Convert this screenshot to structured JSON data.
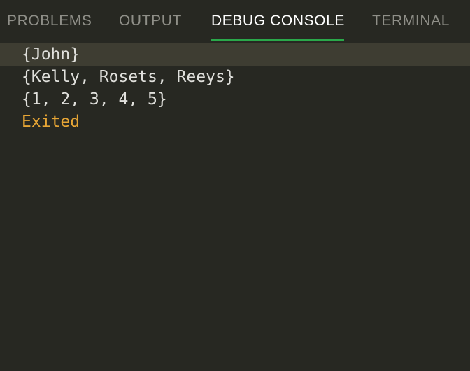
{
  "tabs": [
    {
      "label": "PROBLEMS",
      "active": false
    },
    {
      "label": "OUTPUT",
      "active": false
    },
    {
      "label": "DEBUG CONSOLE",
      "active": true
    },
    {
      "label": "TERMINAL",
      "active": false
    }
  ],
  "console": {
    "lines": [
      {
        "text": "{John}"
      },
      {
        "text": "{Kelly, Rosets, Reeys}"
      },
      {
        "text": "{1, 2, 3, 4, 5}"
      },
      {
        "text": "Exited"
      }
    ]
  },
  "colors": {
    "background": "#272822",
    "active_tab_underline": "#2aa84a",
    "status_text": "#e6a535",
    "highlight_line": "#3e3d32"
  }
}
